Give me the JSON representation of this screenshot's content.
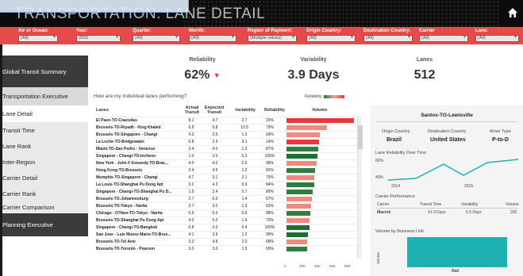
{
  "header": {
    "title": "TRANSPORTATION: LANE DETAIL"
  },
  "filters": [
    {
      "label": "Air or Ocean:",
      "value": "(All)"
    },
    {
      "label": "Year:",
      "value": "2015"
    },
    {
      "label": "Quarter:",
      "value": "(All)"
    },
    {
      "label": "Month:",
      "value": "(All)"
    },
    {
      "label": "Region of Payment:",
      "value": "(Multiple values)"
    },
    {
      "label": "Origin Country:",
      "value": "(All)"
    },
    {
      "label": "Destination Country:",
      "value": "(All)"
    },
    {
      "label": "Carrier",
      "value": "(All)"
    },
    {
      "label": "Lane:",
      "value": "(All)"
    }
  ],
  "sidebar": {
    "items": [
      {
        "label": "Global Transit Summary"
      },
      {
        "label": "Transportation Executive"
      },
      {
        "label": "Lane Detail"
      },
      {
        "label": "Transit Time"
      },
      {
        "label": "Lane Rank"
      },
      {
        "label": "Inter-Region"
      },
      {
        "label": "Carrier Detail"
      },
      {
        "label": "Carrier Rank"
      },
      {
        "label": "Carrier Comparison"
      },
      {
        "label": "Planning Executive"
      }
    ]
  },
  "kpis": {
    "reliability": {
      "label": "Reliability",
      "value": "62%"
    },
    "variability": {
      "label": "Variability",
      "value": "3.9 Days"
    },
    "lanes": {
      "label": "Lanes",
      "value": "512"
    }
  },
  "table": {
    "question": "How are my individual lanes performing?",
    "legend_label": "Reliability",
    "headers": {
      "lanes": "Lanes",
      "actual": "Actual Transit",
      "expected": "Expected Transit",
      "variability": "Variability",
      "reliability": "Reliability",
      "volume": "Volume"
    },
    "rows": [
      {
        "lane": "El Paso-TO-Coacuilas",
        "actual": "8.1",
        "expected": "4.7",
        "variability": "2.7",
        "reliability": "33%",
        "volume": 700,
        "color": "#e63a3a"
      },
      {
        "lane": "Brussels-TO-Riyadh - King Khaled",
        "actual": "6.8",
        "expected": "5.8",
        "variability": "10.5",
        "reliability": "79%",
        "volume": 420,
        "color": "#f08a80"
      },
      {
        "lane": "Brussels-TO-Singapore - Changi",
        "actual": "4.3",
        "expected": "2.5",
        "variability": "1.3",
        "reliability": "69%",
        "volume": 345,
        "color": "#f08a80"
      },
      {
        "lane": "La Loche-TO-Bridgewater",
        "actual": "6.8",
        "expected": "2.5",
        "variability": "3.1",
        "reliability": "14%",
        "volume": 335,
        "color": "#e63a3a"
      },
      {
        "lane": "Miami-TO-San Pedro - Veracruz",
        "actual": "3.4",
        "expected": "4.0",
        "variability": "1.2",
        "reliability": "87%",
        "volume": 330,
        "color": "#2f7d3f"
      },
      {
        "lane": "Singapore - Changi-TO-Incheon",
        "actual": "1.0",
        "expected": "2.0",
        "variability": "0.3",
        "reliability": "100%",
        "volume": 325,
        "color": "#1f6f35"
      },
      {
        "lane": "New York - John F Kennedy-TO-Bras...",
        "actual": "4.0",
        "expected": "4.0",
        "variability": "2.6",
        "reliability": "68%",
        "volume": 315,
        "color": "#f08a80"
      },
      {
        "lane": "Hong Kong-TO-Brussels",
        "actual": "3.4",
        "expected": "4.6",
        "variability": "1.2",
        "reliability": "82%",
        "volume": 300,
        "color": "#2f7d3f"
      },
      {
        "lane": "Memphis-TO-Singapore - Changi",
        "actual": "4.7",
        "expected": "3.1",
        "variability": "2.1",
        "reliability": "79%",
        "volume": 290,
        "color": "#f08a80"
      },
      {
        "lane": "La Louis-TO-Shanghai Pu Dong Apt",
        "actual": "3.2",
        "expected": "4.3",
        "variability": "0.9",
        "reliability": "84%",
        "volume": 285,
        "color": "#2f7d3f"
      },
      {
        "lane": "Singapore - Changi-TO-Shanghai Pu D...",
        "actual": "1.5",
        "expected": "2.4",
        "variability": "0.7",
        "reliability": "89%",
        "volume": 275,
        "color": "#2f7d3f"
      },
      {
        "lane": "Brussels-TO-Johannesburg",
        "actual": "2.7",
        "expected": "5.0",
        "variability": "1.4",
        "reliability": "57%",
        "volume": 265,
        "color": "#f08a80"
      },
      {
        "lane": "Brussels-TO-Tokyo - Narita",
        "actual": "2.7",
        "expected": "3.0",
        "variability": "1.3",
        "reliability": "63%",
        "volume": 255,
        "color": "#f08a80"
      },
      {
        "lane": "Chicago - O'Hare-TO-Tokyo - Narita",
        "actual": "5.5",
        "expected": "5.0",
        "variability": "0.6",
        "reliability": "88%",
        "volume": 245,
        "color": "#2f7d3f"
      },
      {
        "lane": "Brussels-TO-Shanghai Pu Dong Apt",
        "actual": "4.3",
        "expected": "5.0",
        "variability": "1.9",
        "reliability": "73%",
        "volume": 240,
        "color": "#f08a80"
      },
      {
        "lane": "Singapore - Changi-TO-Bangkok",
        "actual": "0.8",
        "expected": "2.0",
        "variability": "0.4",
        "reliability": "100%",
        "volume": 235,
        "color": "#1f6f35"
      },
      {
        "lane": "San Jose - Luis Munoz Marin-TO-Brus...",
        "actual": "4.1",
        "expected": "3.9",
        "variability": "1.2",
        "reliability": "99%",
        "volume": 225,
        "color": "#1f6f35"
      },
      {
        "lane": "Brussels-TO-Tel Aviv",
        "actual": "3.3",
        "expected": "4.8",
        "variability": "2.0",
        "reliability": "68%",
        "volume": 215,
        "color": "#f08a80"
      },
      {
        "lane": "Brussels-TO-Toronto - Pearson",
        "actual": "3.0",
        "expected": "3.0",
        "variability": "1.5",
        "reliability": "69%",
        "volume": 210,
        "color": "#2f7d3f"
      }
    ],
    "axis_ticks": [
      "0",
      "200",
      "400",
      "600",
      "800"
    ]
  },
  "detail": {
    "lane_title": "Santos-TO-Lewisville",
    "origin_label": "Origin Country",
    "origin_value": "Brazil",
    "dest_label": "Destination Country",
    "dest_value": "United States",
    "move_label": "Move Type",
    "move_value": "P-to-D",
    "trend_title": "Lane Reliability Over Time",
    "trend_y_ticks": [
      "60%",
      "40%"
    ],
    "trend_x_ticks": [
      "2014",
      "2015"
    ],
    "carrier_title": "Carrier Performance",
    "carrier_headers": {
      "carrier": "Carrier",
      "transit": "Transit Time",
      "variability": "Variability",
      "volume": "Volume"
    },
    "carrier_row": {
      "carrier": "Maersk",
      "transit": "41.9 Days",
      "variability": "5.5 Days",
      "volume": "202"
    },
    "volume_title": "Volume by Business Unit",
    "volume_axis_label": "Volume",
    "volume_category": "Rail"
  }
}
